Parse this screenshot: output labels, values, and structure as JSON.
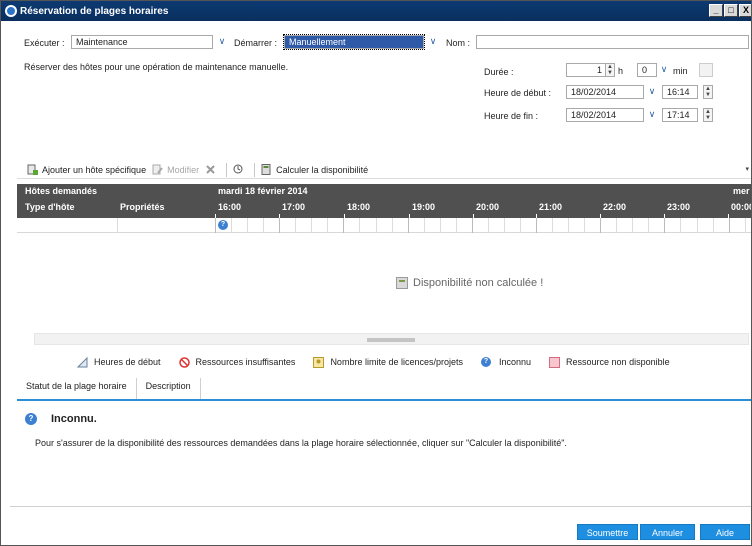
{
  "window": {
    "title": "Réservation de plages horaires",
    "controls": [
      "_",
      "□",
      "X"
    ]
  },
  "top": {
    "executer_label": "Exécuter :",
    "executer_value": "Maintenance",
    "demarrer_label": "Démarrer :",
    "demarrer_value": "Manuellement",
    "nom_label": "Nom :",
    "nom_value": "",
    "description": "Réserver des hôtes pour une opération de maintenance manuelle."
  },
  "timing": {
    "duree_label": "Durée :",
    "duree_hours": "1",
    "hours_unit": "h",
    "duree_minutes": "0",
    "minutes_unit": "min",
    "debut_label": "Heure de début :",
    "debut_date": "18/02/2014",
    "debut_time": "16:14",
    "fin_label": "Heure de fin :",
    "fin_date": "18/02/2014",
    "fin_time": "17:14"
  },
  "toolbar": {
    "add_host": "Ajouter un hôte spécifique",
    "modify": "Modifier",
    "calc": "Calculer la disponibilité"
  },
  "grid": {
    "hosts_requested": "Hôtes demandés",
    "date_label": "mardi 18 février 2014",
    "next_day_label": "mer",
    "col_type": "Type d'hôte",
    "col_props": "Propriétés",
    "hours": [
      "16:00",
      "17:00",
      "18:00",
      "19:00",
      "20:00",
      "21:00",
      "22:00",
      "23:00",
      "00:00"
    ],
    "empty_message": "Disponibilité non calculée !"
  },
  "legend": {
    "start": "Heures de début",
    "insufficient": "Ressources insuffisantes",
    "license": "Nombre limite de licences/projets",
    "unknown": "Inconnu",
    "unavailable": "Ressource non disponible"
  },
  "tabs": {
    "status": "Statut de la plage horaire",
    "description": "Description"
  },
  "status": {
    "title": "Inconnu.",
    "text": "Pour s'assurer de la disponibilité des ressources demandées dans la plage horaire sélectionnée, cliquer sur \"Calculer la disponibilité\"."
  },
  "buttons": {
    "submit": "Soumettre",
    "cancel": "Annuler",
    "help": "Aide"
  },
  "colors": {
    "title_bar": "#0c3a72",
    "accent": "#1e8fe0",
    "grid_header": "#505050"
  }
}
